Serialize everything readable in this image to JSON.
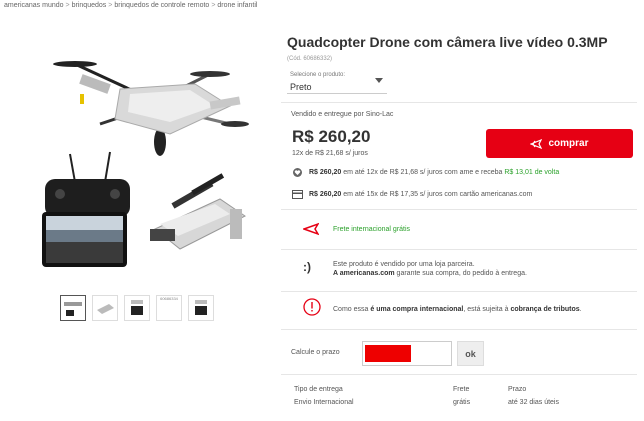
{
  "breadcrumb": [
    "americanas mundo",
    "brinquedos",
    "brinquedos de controle remoto",
    "drone infantil"
  ],
  "breadcrumb_sep": ">",
  "product": {
    "title": "Quadcopter Drone com câmera live vídeo 0.3MP",
    "code": "(Cód. 60686332)"
  },
  "variant": {
    "label": "Selecione o produto:",
    "value": "Preto"
  },
  "offer": {
    "seller": "Vendido e entregue por Sino-Lac",
    "price": "R$ 260,20",
    "installments": "12x de R$ 21,68 s/ juros",
    "buy_label": "comprar"
  },
  "payments": [
    {
      "bold": "R$ 260,20",
      "text": " em até 12x de R$ 21,68 s/ juros com ame e receba ",
      "green": "R$ 13,01 de volta"
    },
    {
      "bold": "R$ 260,20",
      "text": " em até 15x de R$ 17,35 s/ juros com cartão americanas.com",
      "green": ""
    }
  ],
  "shipping_free": "Frete internacional grátis",
  "partner": {
    "line1": "Este produto é vendido por uma loja parceira.",
    "line2_bold": "A americanas.com",
    "line2_rest": " garante sua compra, do pedido à entrega."
  },
  "international": {
    "pre": "Como essa ",
    "bold1": "é uma compra internacional",
    "mid": ", está sujeita à ",
    "bold2": "cobrança de tributos",
    "end": "."
  },
  "cep": {
    "label": "Calcule o prazo",
    "button": "ok"
  },
  "shipping_table": {
    "headers": [
      "Tipo de entrega",
      "Frete",
      "Prazo"
    ],
    "row": [
      "Envio Internacional",
      "grátis",
      "até 32 dias úteis"
    ]
  },
  "thumbs": [
    "",
    "",
    "",
    "60686334",
    ""
  ],
  "colors": {
    "accent": "#e60014",
    "green": "#2ba12b"
  }
}
